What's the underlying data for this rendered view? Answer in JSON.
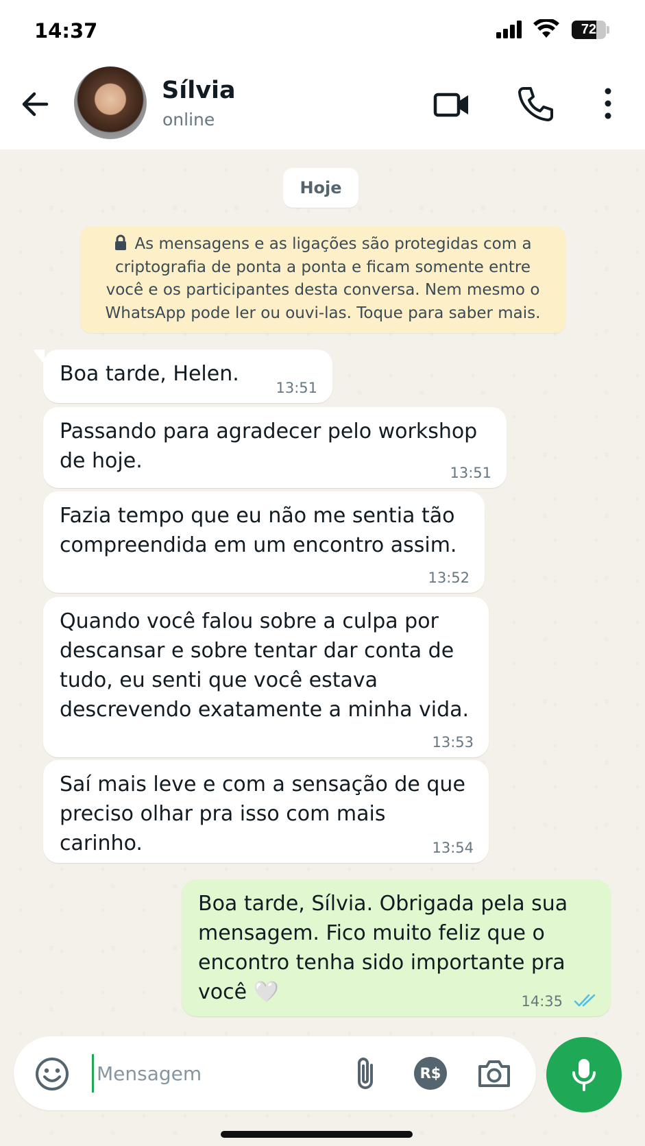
{
  "status_bar": {
    "time": "14:37",
    "battery": "72",
    "battery_level": 0.72
  },
  "header": {
    "contact_name": "Sílvia",
    "contact_status": "online"
  },
  "chat": {
    "date_chip": "Hoje",
    "encryption_notice": "As mensagens e as ligações são protegidas com a\ncriptografia de ponta a ponta e ficam somente entre\nvocê e os participantes desta conversa. Nem mesmo o\nWhatsApp pode ler ou ouvi-las. Toque para saber mais.",
    "messages": [
      {
        "direction": "incoming",
        "text": "Boa tarde, Helen.",
        "time": "13:51"
      },
      {
        "direction": "incoming",
        "text": "Passando para agradecer pelo workshop\nde hoje.",
        "time": "13:51"
      },
      {
        "direction": "incoming",
        "text": "Fazia tempo que eu não me sentia tão\ncompreendida em um encontro assim.",
        "time": "13:52"
      },
      {
        "direction": "incoming",
        "text": "Quando você falou sobre a culpa por\ndescansar e sobre tentar dar conta de\ntudo, eu senti que você estava\ndescrevendo exatamente a minha vida.",
        "time": "13:53"
      },
      {
        "direction": "incoming",
        "text": "Saí mais leve e com a sensação de que\npreciso olhar pra isso com mais carinho.",
        "time": "13:54"
      },
      {
        "direction": "outgoing",
        "text": "Boa tarde, Sílvia. Obrigada pela sua\nmensagem. Fico muito feliz que o\nencontro tenha sido importante pra\nvocê 🤍",
        "time": "14:35",
        "status": "read"
      }
    ]
  },
  "input_bar": {
    "placeholder": "Mensagem",
    "pay_label": "R$"
  },
  "colors": {
    "accent_green": "#1fa855",
    "outgoing_bubble": "#e1f7d0",
    "notice_bg": "#fdf0c8",
    "read_receipt": "#53bdeb"
  }
}
